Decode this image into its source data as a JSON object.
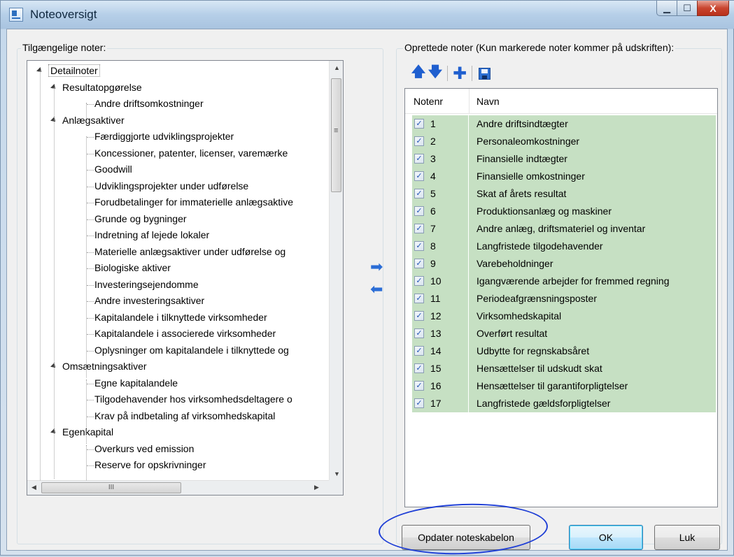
{
  "window": {
    "title": "Noteoversigt",
    "icon": "app-icon",
    "controls": {
      "minimize": "▁",
      "maximize": "☐",
      "close": "X"
    }
  },
  "left_panel": {
    "label": "Tilgængelige noter:",
    "tree": [
      {
        "text": "Detailnoter",
        "level": 0,
        "expanded": true,
        "selected": true
      },
      {
        "text": "Resultatopgørelse",
        "level": 1,
        "expanded": true
      },
      {
        "text": "Andre driftsomkostninger",
        "level": 2
      },
      {
        "text": "Anlægsaktiver",
        "level": 1,
        "expanded": true
      },
      {
        "text": "Færdiggjorte udviklingsprojekter",
        "level": 2
      },
      {
        "text": "Koncessioner, patenter, licenser, varemærke",
        "level": 2
      },
      {
        "text": "Goodwill",
        "level": 2
      },
      {
        "text": "Udviklingsprojekter under udførelse",
        "level": 2
      },
      {
        "text": "Forudbetalinger for immaterielle anlægsaktive",
        "level": 2
      },
      {
        "text": "Grunde og bygninger",
        "level": 2
      },
      {
        "text": "Indretning af lejede lokaler",
        "level": 2
      },
      {
        "text": "Materielle anlægsaktiver under udførelse og",
        "level": 2
      },
      {
        "text": "Biologiske aktiver",
        "level": 2
      },
      {
        "text": "Investeringsejendomme",
        "level": 2
      },
      {
        "text": "Andre investeringsaktiver",
        "level": 2
      },
      {
        "text": "Kapitalandele i tilknyttede virksomheder",
        "level": 2
      },
      {
        "text": "Kapitalandele i associerede virksomheder",
        "level": 2
      },
      {
        "text": "Oplysninger om kapitalandele i tilknyttede og",
        "level": 2
      },
      {
        "text": "Omsætningsaktiver",
        "level": 1,
        "expanded": true
      },
      {
        "text": "Egne kapitalandele",
        "level": 2
      },
      {
        "text": "Tilgodehavender hos virksomhedsdeltagere o",
        "level": 2
      },
      {
        "text": "Krav på indbetaling af virksomhedskapital",
        "level": 2
      },
      {
        "text": "Egenkapital",
        "level": 1,
        "expanded": true
      },
      {
        "text": "Overkurs ved emission",
        "level": 2
      },
      {
        "text": "Reserve for opskrivninger",
        "level": 2
      }
    ],
    "scroll_grip": "≡",
    "hscroll_grip": "III"
  },
  "move_buttons": {
    "add": "➡",
    "remove": "⬅"
  },
  "right_panel": {
    "label": "Oprettede noter (Kun markerede noter kommer på udskriften):",
    "toolbar": {
      "up_icon": "arrow-up-icon",
      "down_icon": "arrow-down-icon",
      "add_icon": "plus-icon",
      "save_icon": "save-icon"
    },
    "columns": [
      "Notenr",
      "Navn"
    ],
    "rows": [
      {
        "nr": "1",
        "name": "Andre driftsindtægter",
        "checked": true
      },
      {
        "nr": "2",
        "name": "Personaleomkostninger",
        "checked": true
      },
      {
        "nr": "3",
        "name": "Finansielle indtægter",
        "checked": true
      },
      {
        "nr": "4",
        "name": "Finansielle omkostninger",
        "checked": true
      },
      {
        "nr": "5",
        "name": "Skat af årets resultat",
        "checked": true
      },
      {
        "nr": "6",
        "name": "Produktionsanlæg og maskiner",
        "checked": true
      },
      {
        "nr": "7",
        "name": "Andre anlæg, driftsmateriel og inventar",
        "checked": true
      },
      {
        "nr": "8",
        "name": "Langfristede tilgodehavender",
        "checked": true
      },
      {
        "nr": "9",
        "name": "Varebeholdninger",
        "checked": true
      },
      {
        "nr": "10",
        "name": "Igangværende arbejder for fremmed regning",
        "checked": true
      },
      {
        "nr": "11",
        "name": "Periodeafgrænsningsposter",
        "checked": true
      },
      {
        "nr": "12",
        "name": "Virksomhedskapital",
        "checked": true
      },
      {
        "nr": "13",
        "name": "Overført resultat",
        "checked": true
      },
      {
        "nr": "14",
        "name": "Udbytte for regnskabsåret",
        "checked": true
      },
      {
        "nr": "15",
        "name": "Hensættelser til udskudt skat",
        "checked": true
      },
      {
        "nr": "16",
        "name": "Hensættelser til garantiforpligtelser",
        "checked": true
      },
      {
        "nr": "17",
        "name": "Langfristede gældsforpligtelser",
        "checked": true
      }
    ],
    "check_glyph": "✓",
    "row_color": "#c6e0c3"
  },
  "buttons": {
    "update": "Opdater noteskabelon",
    "ok": "OK",
    "close": "Luk"
  },
  "annotation_color": "#1f3fd6"
}
